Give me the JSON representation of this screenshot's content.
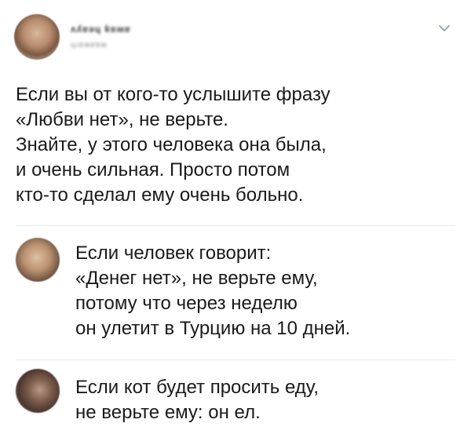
{
  "tweet": {
    "author_name": "ʌʎɐǝɥ ƙɐʍɐ",
    "author_handle": "ɥɹɐʍɐɐʍ",
    "text": "Если вы от кого-то услышите фразу\n«Любви нет», не верьте.\nЗнайте, у этого человека она была,\nи очень сильная. Просто потом\nкто-то сделал ему очень больно."
  },
  "menu": {
    "icon": "chevron-down-icon"
  },
  "replies": [
    {
      "text": "Если человек говорит:\n«Денег нет», не верьте ему,\nпотому что через неделю\nон улетит в Турцию на 10 дней."
    },
    {
      "text": "Если кот будет просить еду,\nне верьте ему: он ел."
    }
  ]
}
